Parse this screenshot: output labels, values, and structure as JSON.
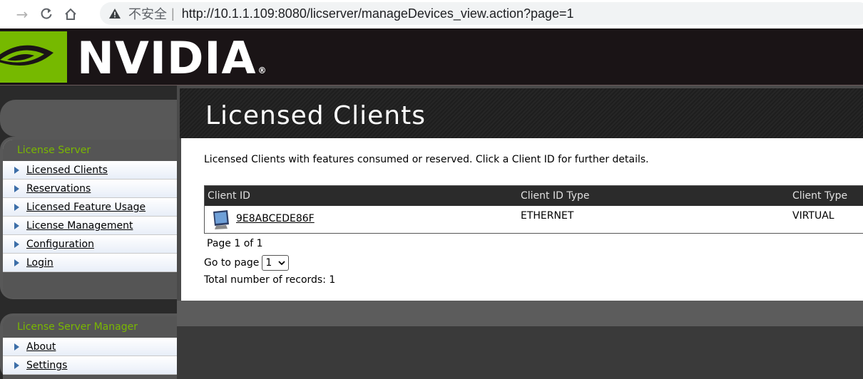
{
  "browser": {
    "insecure_label": "不安全",
    "separator": "|",
    "url": "http://10.1.1.109:8080/licserver/manageDevices_view.action?page=1"
  },
  "header": {
    "logo_text": "NVIDIA",
    "logo_mark": "®",
    "brand_color": "#76b900"
  },
  "sidebar": {
    "section1": {
      "title": "License Server",
      "items": [
        {
          "label": "Licensed Clients",
          "active": true
        },
        {
          "label": "Reservations"
        },
        {
          "label": "Licensed Feature Usage"
        },
        {
          "label": "License Management"
        },
        {
          "label": "Configuration"
        },
        {
          "label": "Login"
        }
      ]
    },
    "section2": {
      "title": "License Server Manager",
      "items": [
        {
          "label": "About"
        },
        {
          "label": "Settings"
        }
      ]
    }
  },
  "main": {
    "title": "Licensed Clients",
    "intro": "Licensed Clients with features consumed or reserved. Click a Client ID for further details.",
    "table": {
      "headers": [
        "Client ID",
        "Client ID Type",
        "Client Type"
      ],
      "rows": [
        {
          "client_id": "9E8ABCEDE86F",
          "id_type": "ETHERNET",
          "client_type": "VIRTUAL"
        }
      ]
    },
    "pager_text": "Page 1 of 1",
    "goto_label": "Go to page",
    "goto_value": "1",
    "total_text": "Total number of records: 1"
  }
}
